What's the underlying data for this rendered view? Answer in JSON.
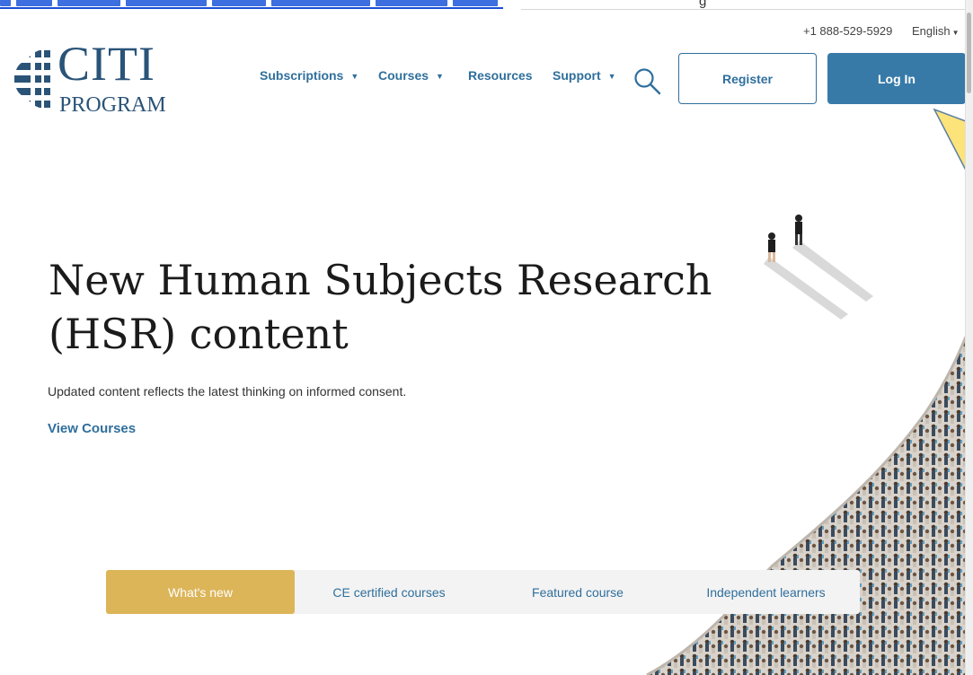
{
  "annotation": {
    "fragment": "g"
  },
  "header": {
    "phone": "+1 888-529-5929",
    "language": "English",
    "logo": {
      "main": "CITI",
      "sub": "PROGRAM"
    },
    "nav": [
      {
        "label": "Subscriptions",
        "dropdown": true
      },
      {
        "label": "Courses",
        "dropdown": true
      },
      {
        "label": "Resources",
        "dropdown": false
      },
      {
        "label": "Support",
        "dropdown": true
      }
    ],
    "search_icon": "search-icon",
    "register_label": "Register",
    "login_label": "Log In"
  },
  "hero": {
    "title": "New Human Subjects Research (HSR) content",
    "subtitle": "Updated content reflects the latest thinking on informed consent.",
    "cta": "View Courses"
  },
  "tabs": [
    {
      "label": "What's new",
      "active": true
    },
    {
      "label": "CE certified courses",
      "active": false
    },
    {
      "label": "Featured course",
      "active": false
    },
    {
      "label": "Independent learners",
      "active": false
    }
  ],
  "colors": {
    "brand_blue": "#2f6f9c",
    "login_bg": "#377aa8",
    "tab_active": "#dcb559",
    "callout": "#fce37a"
  }
}
